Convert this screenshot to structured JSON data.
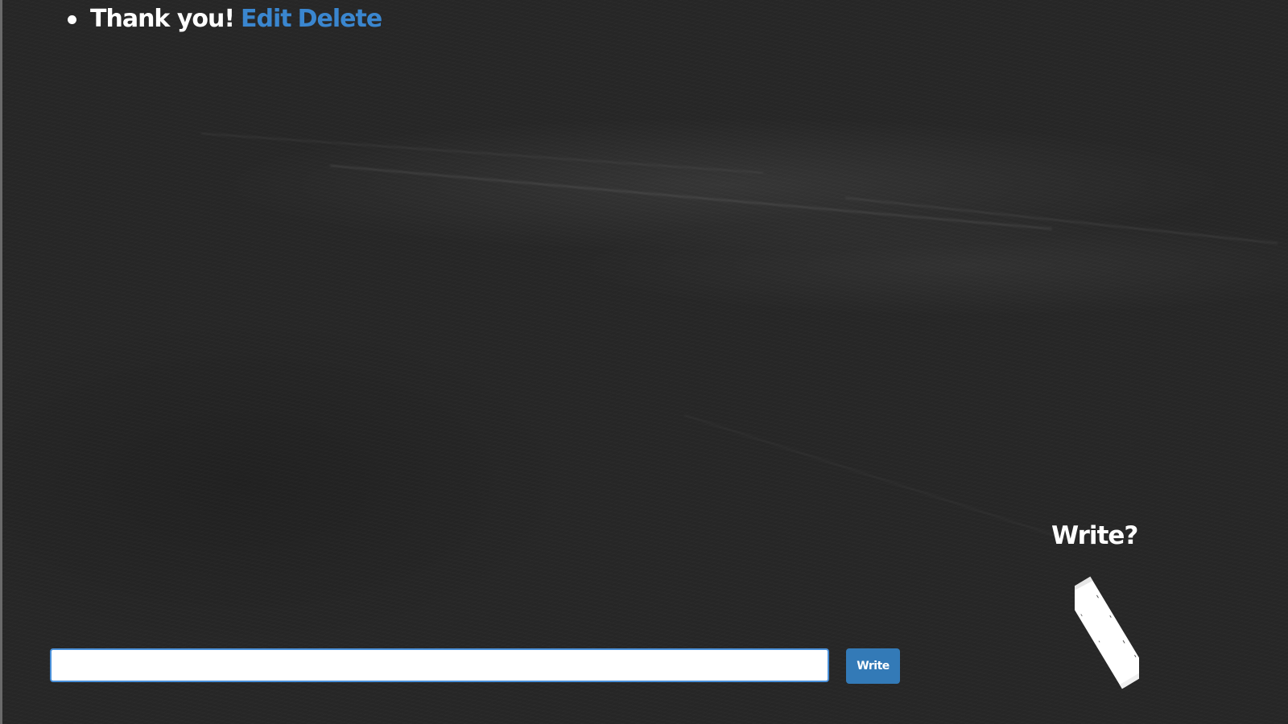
{
  "todos": [
    {
      "text": "Thank you!",
      "edit_label": "Edit",
      "delete_label": "Delete"
    }
  ],
  "entry": {
    "value": "",
    "placeholder": "",
    "button_label": "Write"
  },
  "chalk_prompt": {
    "label": "Write?",
    "icon": "chalk-icon"
  },
  "colors": {
    "background": "#262626",
    "link": "#3a86cf",
    "button": "#337ab7",
    "text": "#ffffff"
  }
}
